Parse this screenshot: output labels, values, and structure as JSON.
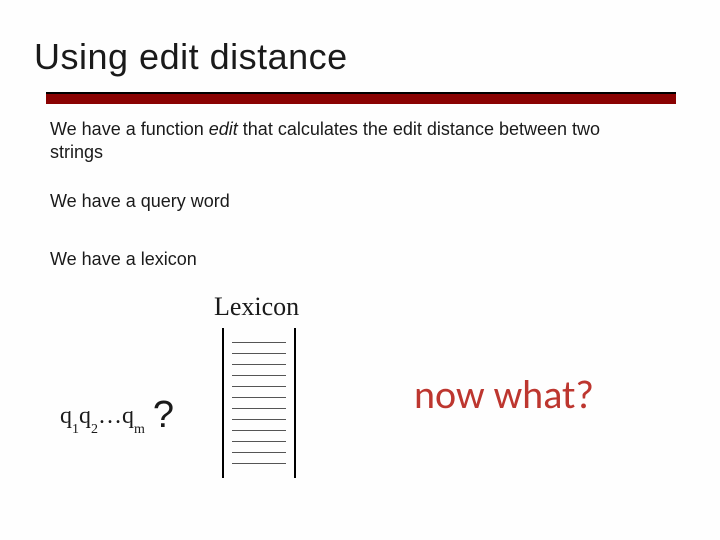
{
  "title": "Using edit distance",
  "body": {
    "line1_a": "We have a function ",
    "line1_em": "edit",
    "line1_b": " that calculates the edit distance between two strings",
    "line2": "We have a query word",
    "line3": "We have a lexicon"
  },
  "lexicon_label": "Lexicon",
  "query": {
    "q": "q",
    "s1": "1",
    "s2": "2",
    "dots": "…",
    "sm": "m",
    "qmark": "?"
  },
  "callout": "now what?",
  "lexicon_lines": 12
}
